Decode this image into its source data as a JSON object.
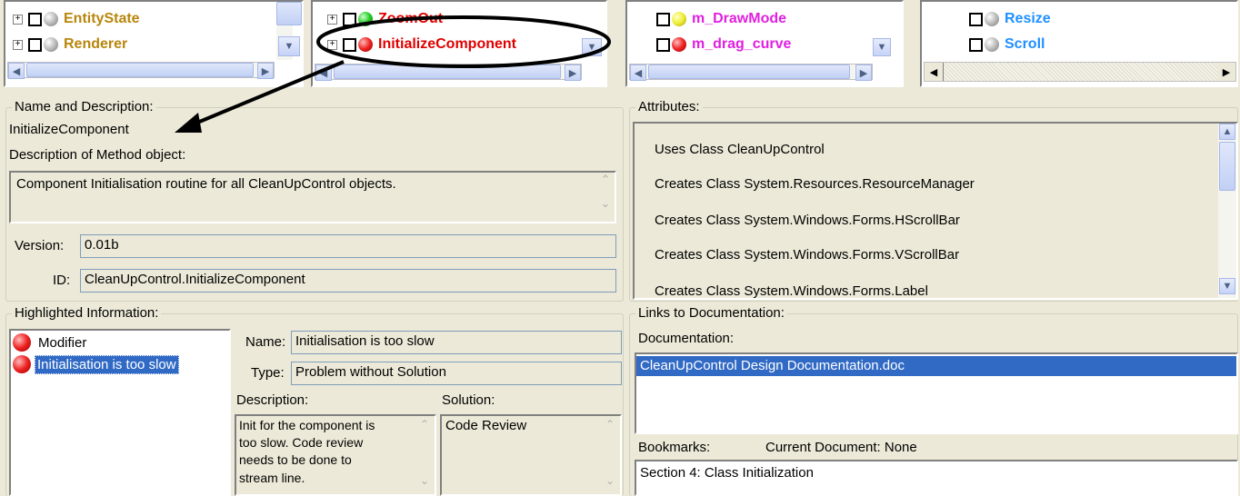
{
  "tree_panels": {
    "panel1": {
      "items": [
        {
          "label": "EntityState",
          "color": "#b8860b",
          "ball": "gray"
        },
        {
          "label": "Renderer",
          "color": "#b8860b",
          "ball": "gray"
        }
      ]
    },
    "panel2": {
      "items": [
        {
          "label": "ZoomOut",
          "color": "#e00000",
          "ball": "green"
        },
        {
          "label": "InitializeComponent",
          "color": "#e00000",
          "ball": "red"
        }
      ]
    },
    "panel3": {
      "items": [
        {
          "label": "m_DrawMode",
          "color": "#e020e0",
          "ball": "yellow"
        },
        {
          "label": "m_drag_curve",
          "color": "#e020e0",
          "ball": "red"
        }
      ]
    },
    "panel4": {
      "items": [
        {
          "label": "Resize",
          "color": "#1e90ff",
          "ball": "gray"
        },
        {
          "label": "Scroll",
          "color": "#1e90ff",
          "ball": "gray"
        }
      ]
    }
  },
  "name_desc": {
    "title": "Name and Description:",
    "name": "InitializeComponent",
    "desc_label": "Description of Method object:",
    "description": "Component Initialisation routine for all CleanUpControl objects.",
    "version_label": "Version:",
    "version": "0.01b",
    "id_label": "ID:",
    "id": "CleanUpControl.InitializeComponent"
  },
  "attributes": {
    "title": "Attributes:",
    "items": [
      "Uses Class CleanUpControl",
      "Creates Class System.Resources.ResourceManager",
      "Creates Class System.Windows.Forms.HScrollBar",
      "Creates Class System.Windows.Forms.VScrollBar",
      "Creates Class System.Windows.Forms.Label"
    ]
  },
  "highlighted": {
    "title": "Highlighted Information:",
    "items": [
      "Modifier",
      "Initialisation is too slow"
    ],
    "name_label": "Name:",
    "name": "Initialisation is too slow",
    "type_label": "Type:",
    "type": "Problem without Solution",
    "desc_label": "Description:",
    "description_lines": [
      "Init for the component is",
      "too slow.  Code review",
      "needs to be done to",
      "stream line."
    ],
    "solution_label": "Solution:",
    "solution": "Code Review"
  },
  "links": {
    "title": "Links to Documentation:",
    "doc_label": "Documentation:",
    "doc_item": "CleanUpControl Design Documentation.doc",
    "bookmarks_label": "Bookmarks:",
    "current_doc": "Current Document:  None",
    "bookmark_item": "Section 4: Class Initialization"
  },
  "colors": {
    "selection": "#316ac5",
    "annotation": "#000000"
  }
}
